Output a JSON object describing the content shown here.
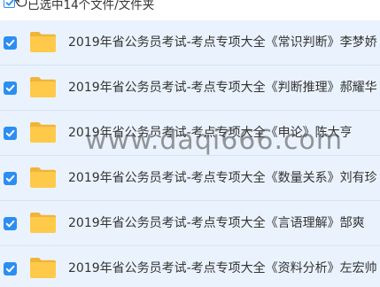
{
  "header": {
    "selection_text": "已选中14个文件/文件夹",
    "checked": true
  },
  "files": [
    {
      "name": "2019年省公务员考试-考点专项大全《常识判断》李梦娇",
      "checked": true,
      "icon": "folder-icon"
    },
    {
      "name": "2019年省公务员考试-考点专项大全《判断推理》郝耀华",
      "checked": true,
      "icon": "folder-icon"
    },
    {
      "name": "2019年省公务员考试-考点专项大全《申论》陈大亨",
      "checked": true,
      "icon": "folder-icon"
    },
    {
      "name": "2019年省公务员考试-考点专项大全《数量关系》刘有珍",
      "checked": true,
      "icon": "folder-icon"
    },
    {
      "name": "2019年省公务员考试-考点专项大全《言语理解》郜爽",
      "checked": true,
      "icon": "folder-icon"
    },
    {
      "name": "2019年省公务员考试-考点专项大全《资料分析》左宏帅",
      "checked": true,
      "icon": "folder-icon"
    }
  ],
  "watermark": "www.daqi666.com",
  "colors": {
    "accent": "#2b8ef0",
    "row_selected_bg": "#eaf3fd",
    "folder": "#ffc94a"
  }
}
